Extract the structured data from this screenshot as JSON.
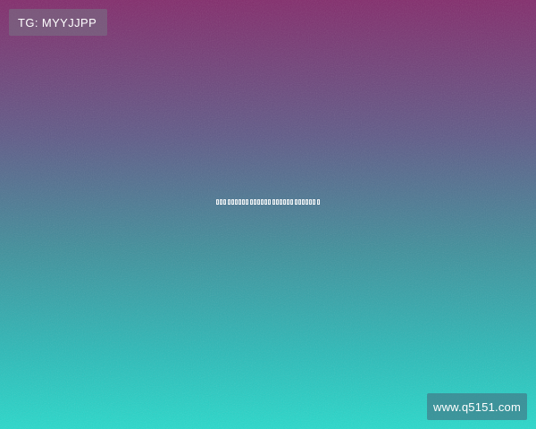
{
  "top_left_tag": "TG: MYYJJPP",
  "bottom_right_url": "www.q5151.com",
  "center_garbled_text": "",
  "colors": {
    "gradient_top": "#822a6b",
    "gradient_mid": "#3f8f9b",
    "gradient_bottom": "#27d9cb",
    "label_text": "#ffffff"
  }
}
